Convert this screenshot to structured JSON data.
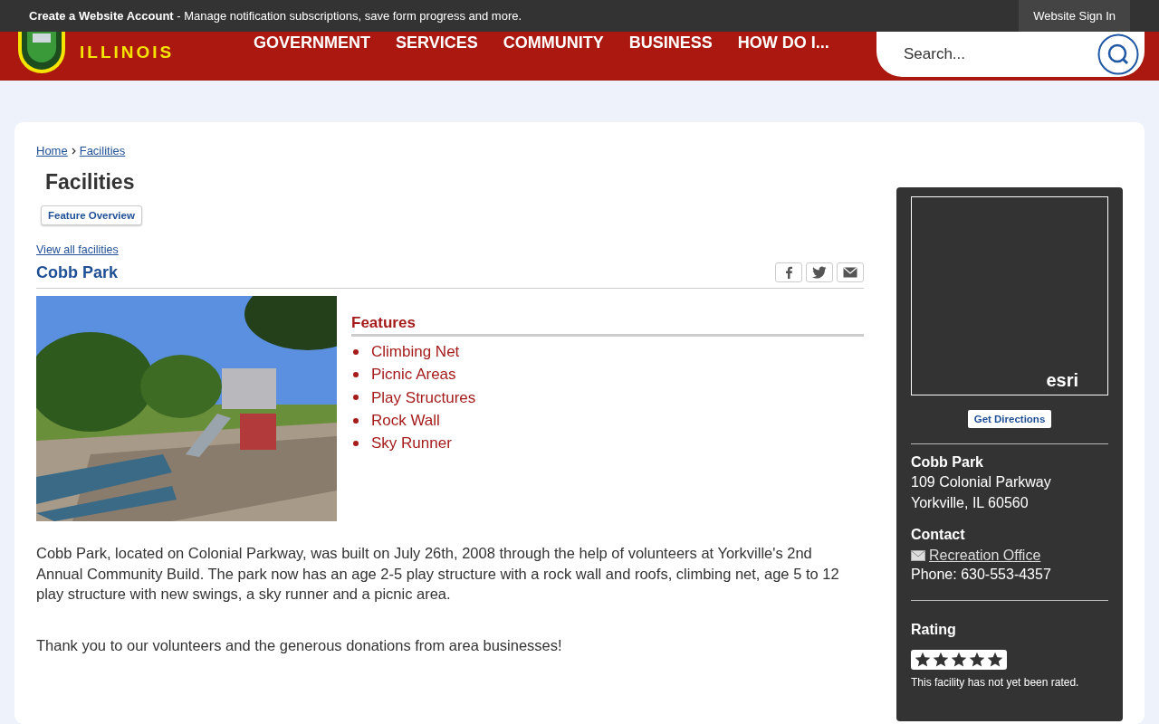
{
  "top_bar": {
    "account_link": "Create a Website Account",
    "account_text": " - Manage notification subscriptions, save form progress and more.",
    "sign_in": "Website Sign In"
  },
  "header": {
    "logo_subtitle": "ILLINOIS",
    "nav": [
      "GOVERNMENT",
      "SERVICES",
      "COMMUNITY",
      "BUSINESS",
      "HOW DO I..."
    ],
    "search": {
      "placeholder": "Search..."
    }
  },
  "breadcrumbs": [
    "Home",
    "Facilities"
  ],
  "page_title": "Facilities",
  "tabs": [
    {
      "label": "Feature Overview",
      "selected": true
    }
  ],
  "view_all": "View all facilities",
  "facility": {
    "name": "Cobb Park",
    "features_title": "Features",
    "features": [
      "Climbing Net",
      "Picnic Areas",
      "Play Structures",
      "Rock Wall",
      "Sky Runner"
    ],
    "description": [
      "Cobb Park, located on Colonial Parkway, was built on July 26th, 2008 through the help of volunteers at Yorkville's 2nd Annual Community Build. The park now has an age 2-5 play structure with a rock wall and roofs, climbing net, age 5 to 12 play structure with new swings, a sky runner and a picnic area.",
      "Thank you to our volunteers and the generous donations from area businesses!"
    ]
  },
  "sidebar": {
    "map_credit": "esri",
    "directions": "Get Directions",
    "name": "Cobb Park",
    "address": [
      "109 Colonial Parkway",
      "Yorkville, IL 60560"
    ],
    "contact_title": "Contact",
    "contact_link": "Recreation Office",
    "phone": "Phone: 630-553-4357",
    "rating_title": "Rating",
    "rating_note": "This facility has not yet been rated."
  }
}
